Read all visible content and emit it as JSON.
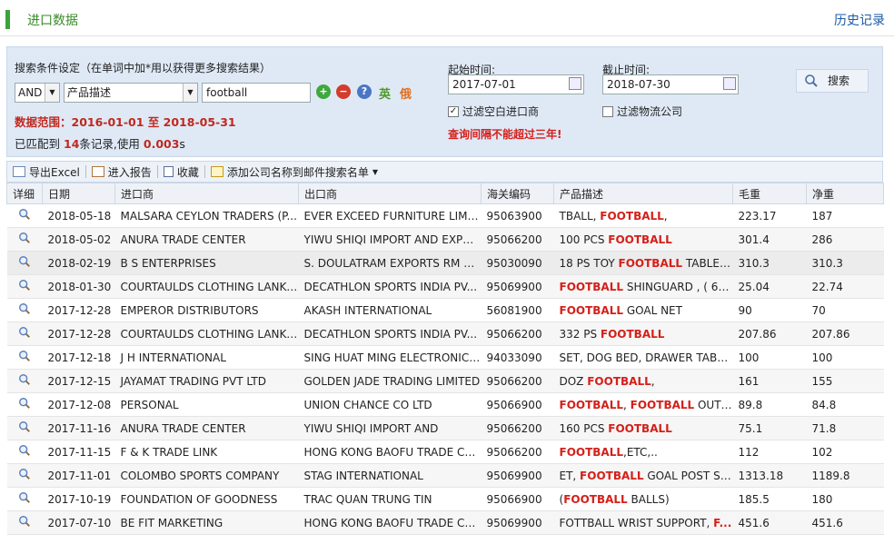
{
  "header": {
    "title": "进口数据",
    "history": "历史记录"
  },
  "search": {
    "label": "搜索条件设定（在单词中加*用以获得更多搜索结果）",
    "logic": "AND",
    "field": "产品描述",
    "keyword": "football",
    "lang_en": "英",
    "lang_ru": "俄",
    "range": "数据范围：2016-01-01 至 2018-05-31",
    "match_prefix": "已匹配到",
    "match_count": "14",
    "match_mid": "条记录,使用",
    "match_time": "0.003",
    "match_suffix": "s",
    "start_label": "起始时间:",
    "start_value": "2017-07-01",
    "end_label": "截止时间:",
    "end_value": "2018-07-30",
    "cb1": "过滤空白进口商",
    "cb2": "过滤物流公司",
    "warning": "查询间隔不能超过三年!",
    "button": "搜索"
  },
  "toolbar": {
    "export": "导出Excel",
    "report": "进入报告",
    "fav": "收藏",
    "mail": "添加公司名称到邮件搜索名单"
  },
  "columns": [
    "详细",
    "日期",
    "进口商",
    "出口商",
    "海关编码",
    "产品描述",
    "毛重",
    "净重"
  ],
  "rows": [
    {
      "date": "2018-05-18",
      "importer": "MALSARA CEYLON TRADERS (P...",
      "exporter": "EVER EXCEED FURNITURE LIMIT...",
      "hs": "95063900",
      "desc": [
        [
          "TBALL, ",
          0
        ],
        [
          "FOOTBALL",
          1
        ],
        [
          ",",
          0
        ]
      ],
      "gross": "223.17",
      "net": "187"
    },
    {
      "date": "2018-05-02",
      "importer": "ANURA TRADE CENTER",
      "exporter": "YIWU SHIQI IMPORT AND EXPO...",
      "hs": "95066200",
      "desc": [
        [
          "100 PCS ",
          0
        ],
        [
          "FOOTBALL",
          1
        ]
      ],
      "gross": "301.4",
      "net": "286"
    },
    {
      "date": "2018-02-19",
      "importer": "B S ENTERPRISES",
      "exporter": "S. DOULATRAM EXPORTS RM A...",
      "hs": "95030090",
      "desc": [
        [
          "18 PS TOY ",
          0
        ],
        [
          "FOOTBALL",
          1
        ],
        [
          " TABLE ...",
          0
        ]
      ],
      "gross": "310.3",
      "net": "310.3"
    },
    {
      "date": "2018-01-30",
      "importer": "COURTAULDS CLOTHING LANKA...",
      "exporter": "DECATHLON SPORTS INDIA PV...",
      "hs": "95069900",
      "desc": [
        [
          "FOOTBALL",
          1
        ],
        [
          " SHINGUARD , ( 69 ...",
          0
        ]
      ],
      "gross": "25.04",
      "net": "22.74"
    },
    {
      "date": "2017-12-28",
      "importer": "EMPEROR DISTRIBUTORS",
      "exporter": "AKASH INTERNATIONAL",
      "hs": "56081900",
      "desc": [
        [
          "FOOTBALL",
          1
        ],
        [
          " GOAL NET",
          0
        ]
      ],
      "gross": "90",
      "net": "70"
    },
    {
      "date": "2017-12-28",
      "importer": "COURTAULDS CLOTHING LANKA...",
      "exporter": "DECATHLON SPORTS INDIA PV...",
      "hs": "95066200",
      "desc": [
        [
          "332 PS ",
          0
        ],
        [
          "FOOTBALL",
          1
        ]
      ],
      "gross": "207.86",
      "net": "207.86"
    },
    {
      "date": "2017-12-18",
      "importer": "J H INTERNATIONAL",
      "exporter": "SING HUAT MING ELECTRONIC ...",
      "hs": "94033090",
      "desc": [
        [
          "SET, DOG BED, DRAWER TABBL...",
          0
        ]
      ],
      "gross": "100",
      "net": "100"
    },
    {
      "date": "2017-12-15",
      "importer": "JAYAMAT TRADING PVT LTD",
      "exporter": "GOLDEN JADE TRADING LIMITED",
      "hs": "95066200",
      "desc": [
        [
          "DOZ ",
          0
        ],
        [
          "FOOTBALL",
          1
        ],
        [
          ",",
          0
        ]
      ],
      "gross": "161",
      "net": "155"
    },
    {
      "date": "2017-12-08",
      "importer": "PERSONAL",
      "exporter": "UNION CHANCE CO LTD",
      "hs": "95066900",
      "desc": [
        [
          "FOOTBALL",
          1
        ],
        [
          ", ",
          0
        ],
        [
          "FOOTBALL",
          1
        ],
        [
          " OUTDO...",
          0
        ]
      ],
      "gross": "89.8",
      "net": "84.8"
    },
    {
      "date": "2017-11-16",
      "importer": "ANURA TRADE CENTER",
      "exporter": "YIWU SHIQI IMPORT AND",
      "hs": "95066200",
      "desc": [
        [
          "160 PCS ",
          0
        ],
        [
          "FOOTBALL",
          1
        ]
      ],
      "gross": "75.1",
      "net": "71.8"
    },
    {
      "date": "2017-11-15",
      "importer": "F & K TRADE LINK",
      "exporter": "HONG KONG BAOFU TRADE CO....",
      "hs": "95066200",
      "desc": [
        [
          "FOOTBALL",
          1
        ],
        [
          ",ETC,..",
          0
        ]
      ],
      "gross": "112",
      "net": "102"
    },
    {
      "date": "2017-11-01",
      "importer": "COLOMBO SPORTS COMPANY",
      "exporter": "STAG INTERNATIONAL",
      "hs": "95069900",
      "desc": [
        [
          "ET, ",
          0
        ],
        [
          "FOOTBALL",
          1
        ],
        [
          " GOAL POST SE...",
          0
        ]
      ],
      "gross": "1313.18",
      "net": "1189.8"
    },
    {
      "date": "2017-10-19",
      "importer": "FOUNDATION OF GOODNESS",
      "exporter": "TRAC QUAN TRUNG TIN",
      "hs": "95066900",
      "desc": [
        [
          "(",
          0
        ],
        [
          "FOOTBALL",
          1
        ],
        [
          " BALLS)",
          0
        ]
      ],
      "gross": "185.5",
      "net": "180"
    },
    {
      "date": "2017-07-10",
      "importer": "BE FIT MARKETING",
      "exporter": "HONG KONG BAOFU TRADE CO....",
      "hs": "95069900",
      "desc": [
        [
          "FOTTBALL WRIST SUPPORT, ",
          0
        ],
        [
          "F...",
          1
        ]
      ],
      "gross": "451.6",
      "net": "451.6"
    }
  ]
}
